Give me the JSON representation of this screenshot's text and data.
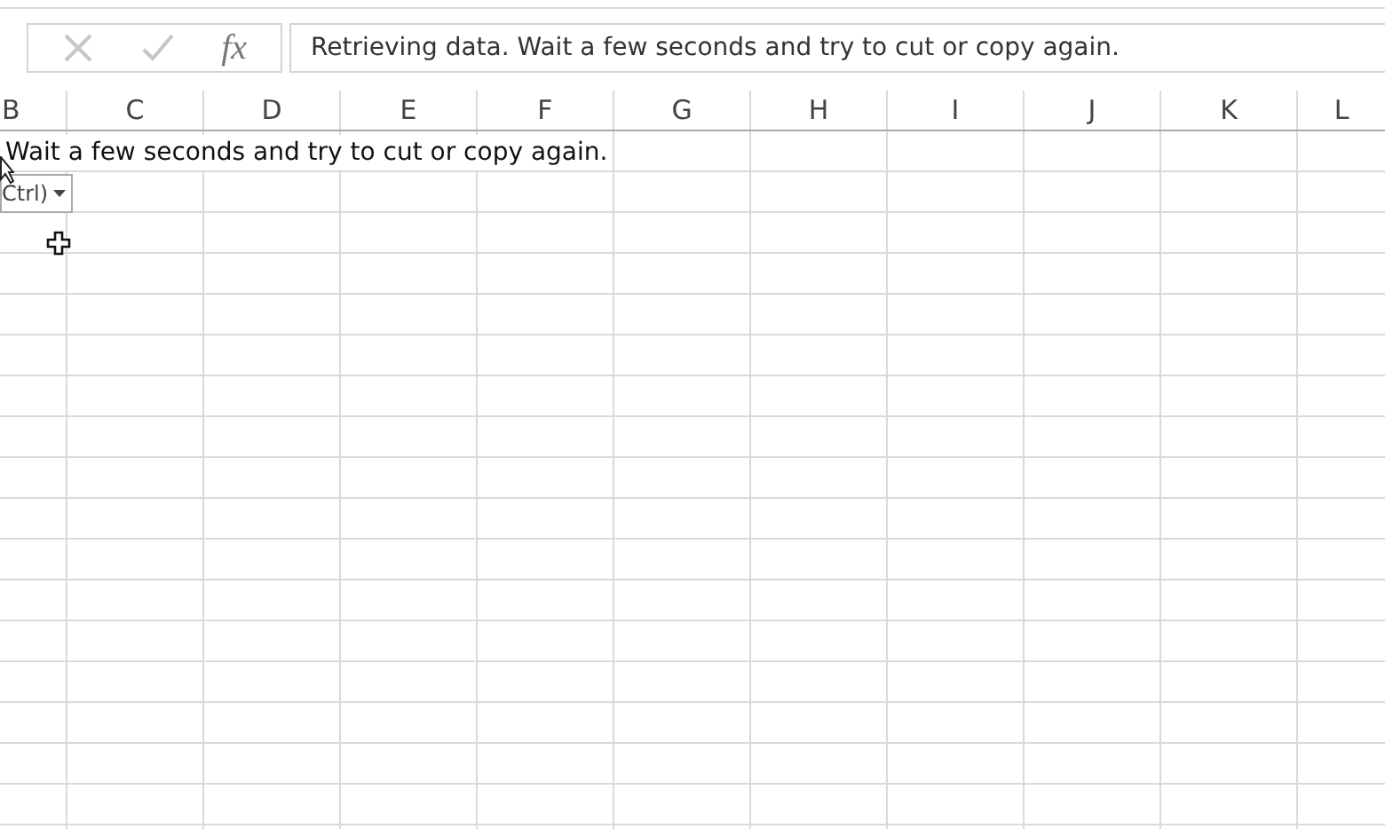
{
  "formula_bar": {
    "function_label": "fx",
    "value": "Retrieving data. Wait a few seconds and try to cut or copy again."
  },
  "columns": [
    "B",
    "C",
    "D",
    "E",
    "F",
    "G",
    "H",
    "I",
    "J",
    "K",
    "L"
  ],
  "cells": [
    {
      "text": "Wait a few seconds and try to cut or copy again."
    }
  ],
  "paste_options": {
    "label": "Ctrl)"
  }
}
